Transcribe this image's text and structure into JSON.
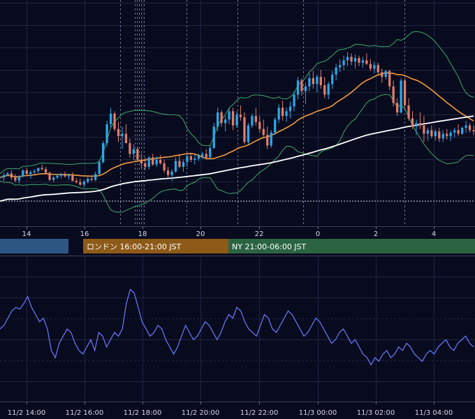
{
  "chart_data": [
    {
      "type": "candlestick",
      "x_ticks": [
        "14",
        "16",
        "18",
        "20",
        "22",
        "0",
        "2",
        "4"
      ],
      "overlays": [
        {
          "name": "",
          "kind": "moving-average",
          "color": "#f39c3c"
        },
        {
          "name": "",
          "kind": "moving-average",
          "color": "#ffffff"
        },
        {
          "name": "",
          "kind": "bollinger-bands",
          "color": "#3fa86a"
        }
      ],
      "candles": [
        [
          0,
          0,
          0,
          0
        ],
        [
          0,
          8,
          -6,
          4
        ],
        [
          4,
          10,
          2,
          7
        ],
        [
          7,
          12,
          -4,
          0
        ],
        [
          0,
          6,
          -8,
          -5
        ],
        [
          -5,
          4,
          -10,
          2
        ],
        [
          2,
          14,
          0,
          12
        ],
        [
          12,
          16,
          4,
          6
        ],
        [
          6,
          12,
          -2,
          9
        ],
        [
          9,
          14,
          6,
          11
        ],
        [
          11,
          17,
          8,
          16
        ],
        [
          16,
          22,
          12,
          14
        ],
        [
          14,
          18,
          6,
          8
        ],
        [
          8,
          10,
          -6,
          -4
        ],
        [
          -4,
          2,
          -8,
          0
        ],
        [
          0,
          6,
          -3,
          3
        ],
        [
          3,
          8,
          -2,
          6
        ],
        [
          6,
          10,
          0,
          2
        ],
        [
          2,
          6,
          -4,
          4
        ],
        [
          4,
          9,
          -6,
          -6
        ],
        [
          -6,
          -1,
          -10,
          -8
        ],
        [
          -8,
          -2,
          -14,
          -12
        ],
        [
          -12,
          -4,
          -16,
          -7
        ],
        [
          -7,
          1,
          -10,
          -2
        ],
        [
          -2,
          2,
          -6,
          -4
        ],
        [
          -4,
          10,
          -6,
          6
        ],
        [
          6,
          30,
          4,
          26
        ],
        [
          26,
          62,
          24,
          58
        ],
        [
          58,
          96,
          52,
          90
        ],
        [
          90,
          118,
          84,
          108
        ],
        [
          108,
          112,
          78,
          82
        ],
        [
          82,
          94,
          60,
          70
        ],
        [
          70,
          86,
          48,
          74
        ],
        [
          74,
          90,
          62,
          58
        ],
        [
          58,
          66,
          34,
          40
        ],
        [
          40,
          56,
          30,
          48
        ],
        [
          48,
          52,
          26,
          30
        ],
        [
          30,
          40,
          16,
          24
        ],
        [
          24,
          34,
          12,
          18
        ],
        [
          18,
          36,
          14,
          34
        ],
        [
          34,
          40,
          20,
          22
        ],
        [
          22,
          36,
          18,
          30
        ],
        [
          30,
          38,
          22,
          24
        ],
        [
          24,
          30,
          8,
          12
        ],
        [
          12,
          18,
          0,
          4
        ],
        [
          4,
          14,
          -6,
          10
        ],
        [
          10,
          34,
          8,
          28
        ],
        [
          28,
          40,
          16,
          18
        ],
        [
          18,
          30,
          10,
          26
        ],
        [
          26,
          40,
          18,
          36
        ],
        [
          36,
          42,
          26,
          30
        ],
        [
          30,
          38,
          22,
          32
        ],
        [
          32,
          40,
          28,
          36
        ],
        [
          36,
          44,
          32,
          40
        ],
        [
          40,
          48,
          30,
          34
        ],
        [
          34,
          54,
          32,
          50
        ],
        [
          50,
          92,
          48,
          86
        ],
        [
          86,
          118,
          78,
          110
        ],
        [
          110,
          114,
          86,
          92
        ],
        [
          92,
          104,
          78,
          98
        ],
        [
          98,
          118,
          90,
          112
        ],
        [
          112,
          118,
          80,
          88
        ],
        [
          88,
          112,
          84,
          106
        ],
        [
          106,
          122,
          96,
          102
        ],
        [
          102,
          110,
          56,
          60
        ],
        [
          60,
          92,
          56,
          88
        ],
        [
          88,
          108,
          84,
          104
        ],
        [
          104,
          118,
          88,
          94
        ],
        [
          94,
          104,
          76,
          82
        ],
        [
          82,
          98,
          66,
          72
        ],
        [
          72,
          86,
          48,
          54
        ],
        [
          54,
          80,
          50,
          76
        ],
        [
          76,
          102,
          72,
          98
        ],
        [
          98,
          124,
          92,
          118
        ],
        [
          118,
          130,
          96,
          104
        ],
        [
          104,
          118,
          94,
          112
        ],
        [
          112,
          128,
          100,
          120
        ],
        [
          120,
          146,
          112,
          140
        ],
        [
          140,
          170,
          132,
          164
        ],
        [
          164,
          168,
          138,
          146
        ],
        [
          146,
          160,
          124,
          154
        ],
        [
          154,
          176,
          146,
          168
        ],
        [
          168,
          180,
          150,
          158
        ],
        [
          158,
          174,
          144,
          170
        ],
        [
          170,
          182,
          150,
          156
        ],
        [
          156,
          170,
          134,
          140
        ],
        [
          140,
          162,
          132,
          158
        ],
        [
          158,
          180,
          150,
          174
        ],
        [
          174,
          192,
          164,
          186
        ],
        [
          186,
          200,
          178,
          190
        ],
        [
          190,
          206,
          182,
          198
        ],
        [
          198,
          212,
          188,
          204
        ],
        [
          204,
          210,
          190,
          196
        ],
        [
          196,
          208,
          184,
          202
        ],
        [
          202,
          206,
          188,
          194
        ],
        [
          194,
          204,
          186,
          198
        ],
        [
          198,
          210,
          190,
          192
        ],
        [
          192,
          200,
          180,
          184
        ],
        [
          184,
          196,
          176,
          190
        ],
        [
          190,
          194,
          174,
          178
        ],
        [
          178,
          184,
          160,
          170
        ],
        [
          170,
          182,
          166,
          180
        ],
        [
          180,
          182,
          148,
          154
        ],
        [
          154,
          164,
          120,
          126
        ],
        [
          126,
          134,
          104,
          110
        ],
        [
          110,
          168,
          108,
          164
        ],
        [
          164,
          168,
          116,
          122
        ],
        [
          122,
          134,
          96,
          100
        ],
        [
          100,
          112,
          82,
          86
        ],
        [
          86,
          98,
          72,
          92
        ],
        [
          92,
          110,
          82,
          88
        ],
        [
          88,
          104,
          60,
          74
        ],
        [
          74,
          84,
          62,
          80
        ],
        [
          80,
          88,
          66,
          70
        ],
        [
          70,
          82,
          62,
          78
        ],
        [
          78,
          84,
          60,
          66
        ],
        [
          66,
          80,
          60,
          74
        ],
        [
          74,
          82,
          64,
          70
        ],
        [
          70,
          80,
          62,
          76
        ],
        [
          76,
          84,
          68,
          80
        ],
        [
          80,
          90,
          70,
          74
        ],
        [
          74,
          86,
          72,
          84
        ],
        [
          84,
          96,
          76,
          88
        ],
        [
          88,
          92,
          76,
          80
        ],
        [
          80,
          88,
          72,
          78
        ]
      ]
    },
    {
      "type": "line",
      "x_ticks": [
        "11/2 14:00",
        "11/2 16:00",
        "11/2 18:00",
        "11/2 20:00",
        "11/2 22:00",
        "11/3 00:00",
        "11/3 02:00",
        "11/3 04:00"
      ],
      "series": [
        {
          "name": "",
          "color": "#6674f2",
          "values": [
            60,
            62,
            66,
            70,
            72,
            71,
            74,
            78,
            72,
            68,
            64,
            66,
            60,
            48,
            44,
            52,
            56,
            60,
            58,
            52,
            48,
            46,
            50,
            54,
            48,
            58,
            56,
            50,
            54,
            58,
            56,
            60,
            74,
            82,
            80,
            72,
            64,
            60,
            56,
            58,
            62,
            60,
            54,
            50,
            46,
            50,
            56,
            62,
            58,
            54,
            56,
            60,
            64,
            62,
            58,
            54,
            58,
            64,
            68,
            66,
            72,
            70,
            64,
            60,
            58,
            56,
            62,
            68,
            66,
            60,
            58,
            62,
            66,
            70,
            68,
            64,
            60,
            56,
            58,
            62,
            66,
            64,
            60,
            56,
            52,
            54,
            58,
            60,
            56,
            52,
            54,
            50,
            46,
            44,
            40,
            44,
            42,
            46,
            48,
            44,
            46,
            50,
            48,
            52,
            50,
            46,
            44,
            42,
            46,
            48,
            46,
            50,
            52,
            54,
            50,
            48,
            52,
            54,
            56,
            52,
            50
          ]
        }
      ]
    }
  ],
  "sessions": [
    {
      "label": "",
      "color": "#2e5683"
    },
    {
      "label": "ロンドン 16:00-21:00 JST",
      "color": "#8d5a17"
    },
    {
      "label": "NY 21:00-06:00 JST",
      "color": "#2b6443"
    }
  ],
  "colors": {
    "background": "#080a1e",
    "up_candle": "#2aa8e8",
    "down_candle": "#e07e6a",
    "grid": "#202540",
    "indicator_line": "#6674f2"
  }
}
